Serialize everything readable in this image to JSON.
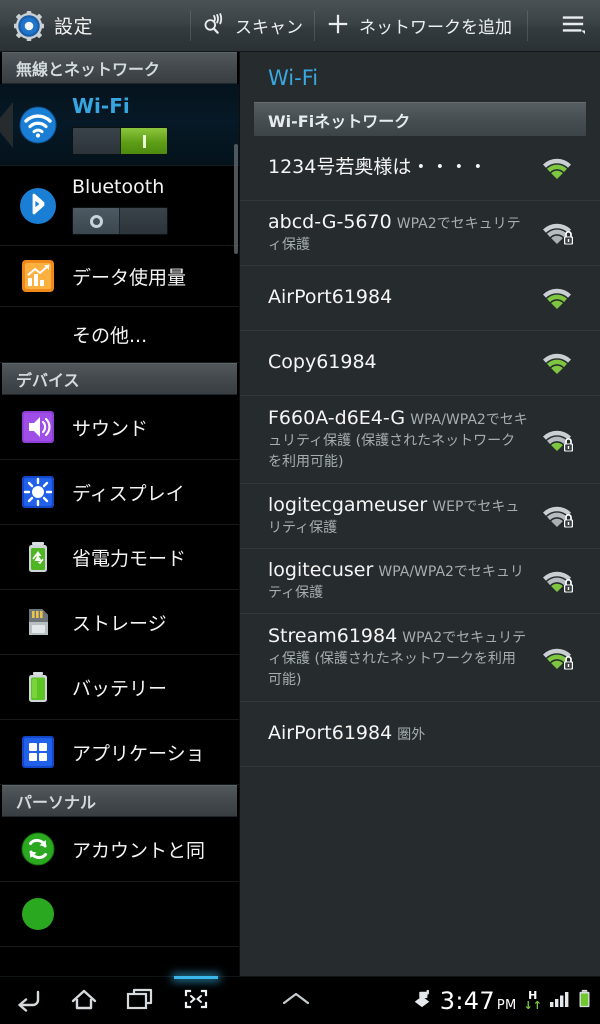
{
  "actionbar": {
    "app_icon": "settings-gear-icon",
    "title": "設定",
    "scan": {
      "label": "スキャン",
      "icon": "scan-wifi-icon"
    },
    "add_network": {
      "label": "ネットワークを追加",
      "icon": "plus-icon"
    },
    "overflow": {
      "icon": "overflow-menu-icon"
    }
  },
  "sidebar": {
    "sections": [
      {
        "header": "無線とネットワーク",
        "items": [
          {
            "label": "Wi-Fi",
            "icon": "wifi-icon",
            "selected": true,
            "toggle": "on",
            "toggle_glyph": "I"
          },
          {
            "label": "Bluetooth",
            "icon": "bluetooth-icon",
            "selected": false,
            "toggle": "off",
            "toggle_glyph": "O"
          },
          {
            "label": "データ使用量",
            "icon": "data-usage-icon",
            "selected": false,
            "toggle": null
          },
          {
            "label": "その他...",
            "icon": null,
            "selected": false,
            "toggle": null
          }
        ]
      },
      {
        "header": "デバイス",
        "items": [
          {
            "label": "サウンド",
            "icon": "sound-icon",
            "selected": false,
            "toggle": null
          },
          {
            "label": "ディスプレイ",
            "icon": "display-icon",
            "selected": false,
            "toggle": null
          },
          {
            "label": "省電力モード",
            "icon": "power-saving-icon",
            "selected": false,
            "toggle": null
          },
          {
            "label": "ストレージ",
            "icon": "storage-icon",
            "selected": false,
            "toggle": null
          },
          {
            "label": "バッテリー",
            "icon": "battery-icon",
            "selected": false,
            "toggle": null
          },
          {
            "label": "アプリケーショ",
            "icon": "applications-icon",
            "selected": false,
            "toggle": null
          }
        ]
      },
      {
        "header": "パーソナル",
        "items": [
          {
            "label": "アカウントと同",
            "icon": "accounts-sync-icon",
            "selected": false,
            "toggle": null
          }
        ]
      }
    ]
  },
  "content": {
    "title": "Wi-Fi",
    "subheader": "Wi-Fiネットワーク",
    "networks": [
      {
        "ssid": "1234号若奥様は・・・・",
        "status": "",
        "secured": false,
        "signal": 4,
        "signal_icon": "wifi-signal-full-icon"
      },
      {
        "ssid": "abcd-G-5670",
        "status": "WPA2でセキュリティ保護",
        "secured": true,
        "signal": 0,
        "signal_icon": "wifi-signal-none-lock-icon"
      },
      {
        "ssid": "AirPort61984",
        "status": "",
        "secured": false,
        "signal": 4,
        "signal_icon": "wifi-signal-full-icon"
      },
      {
        "ssid": "Copy61984",
        "status": "",
        "secured": false,
        "signal": 4,
        "signal_icon": "wifi-signal-full-icon"
      },
      {
        "ssid": "F660A-d6E4-G",
        "status": "WPA/WPA2でセキュリティ保護 (保護されたネットワークを利用可能)",
        "secured": true,
        "signal": 1,
        "signal_icon": "wifi-signal-low-lock-icon"
      },
      {
        "ssid": "logitecgameuser",
        "status": "WEPでセキュリティ保護",
        "secured": true,
        "signal": 0,
        "signal_icon": "wifi-signal-none-lock-icon"
      },
      {
        "ssid": "logitecuser",
        "status": "WPA/WPA2でセキュリティ保護",
        "secured": true,
        "signal": 1,
        "signal_icon": "wifi-signal-low-lock-icon"
      },
      {
        "ssid": "Stream61984",
        "status": "WPA2でセキュリティ保護 (保護されたネットワークを利用可能)",
        "secured": true,
        "signal": 3,
        "signal_icon": "wifi-signal-strong-lock-icon"
      },
      {
        "ssid": "AirPort61984",
        "status": "圏外",
        "secured": false,
        "signal": -1,
        "signal_icon": "none"
      }
    ]
  },
  "sysbar": {
    "back": "back-icon",
    "home": "home-icon",
    "recents": "recents-icon",
    "screenshot": "screen-capture-icon",
    "expand": "chevron-up-icon",
    "notification": "notification-icon",
    "clock_time": "3:47",
    "clock_ampm": "PM",
    "network_type": "H",
    "network_arrows": "↓↑",
    "signal_icon": "cellular-signal-icon",
    "battery_icon": "battery-icon"
  },
  "colors": {
    "accent_blue": "#3aa8e0",
    "toggle_green": "#6ba617",
    "signal_green": "#7ec63f",
    "content_bg": "#262c2e",
    "sidebar_bg": "#000000"
  }
}
